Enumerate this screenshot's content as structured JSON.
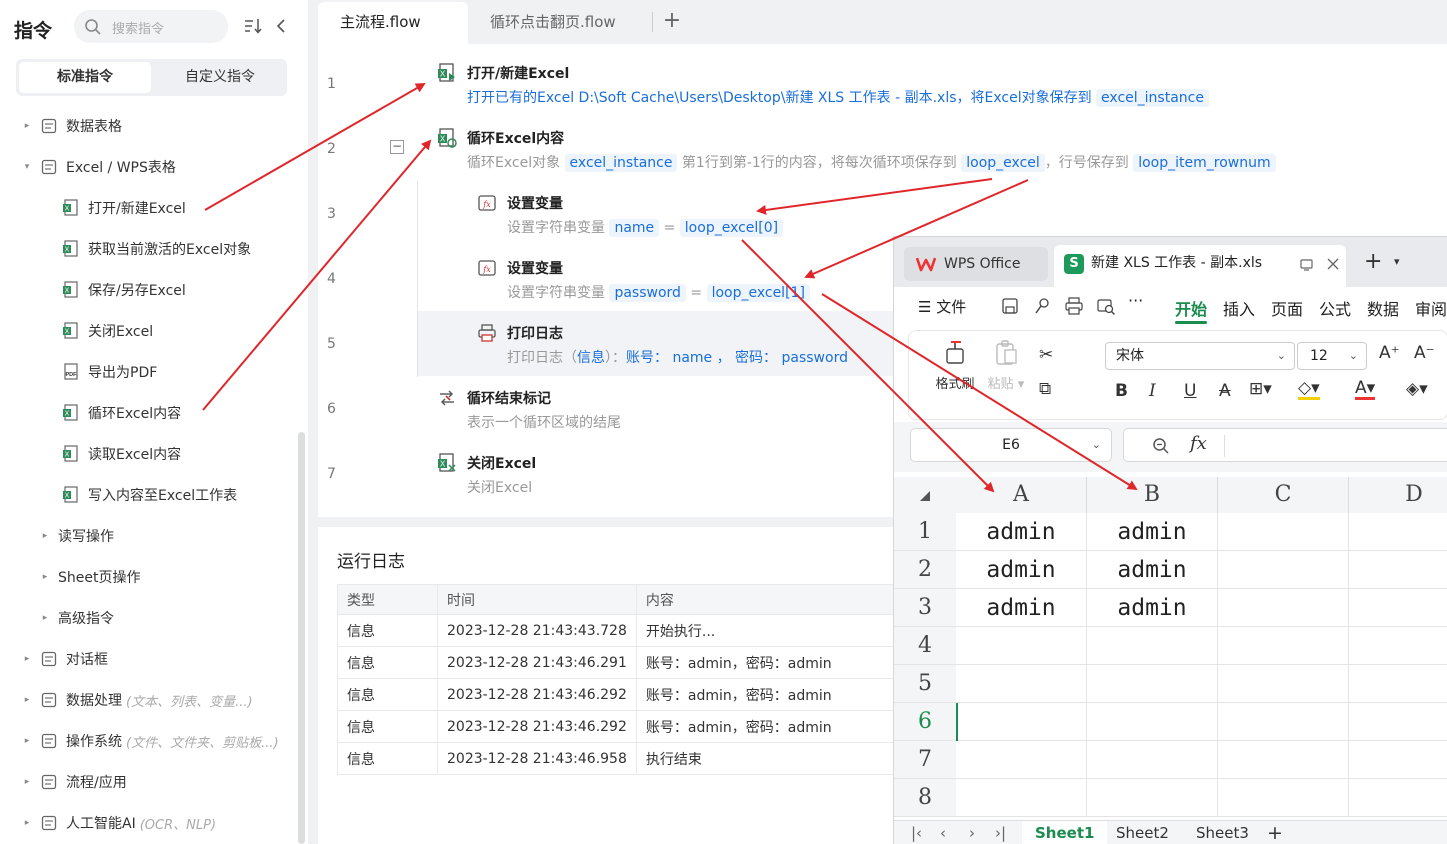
{
  "sidebar": {
    "title": "指令",
    "search_placeholder": "搜索指令",
    "tabs": [
      "标准指令",
      "自定义指令"
    ],
    "tree": [
      {
        "label": "数据表格",
        "level": 0,
        "arrow": "▸",
        "icon": "table-icon"
      },
      {
        "label": "Excel / WPS表格",
        "level": 0,
        "arrow": "▾",
        "icon": "excel-group-icon"
      },
      {
        "label": "打开/新建Excel",
        "level": 2,
        "arrow": "",
        "icon": "excel-open-icon"
      },
      {
        "label": "获取当前激活的Excel对象",
        "level": 2,
        "arrow": "",
        "icon": "excel-active-icon"
      },
      {
        "label": "保存/另存Excel",
        "level": 2,
        "arrow": "",
        "icon": "excel-save-icon"
      },
      {
        "label": "关闭Excel",
        "level": 2,
        "arrow": "",
        "icon": "excel-close-icon"
      },
      {
        "label": "导出为PDF",
        "level": 2,
        "arrow": "",
        "icon": "pdf-icon"
      },
      {
        "label": "循环Excel内容",
        "level": 2,
        "arrow": "",
        "icon": "excel-loop-icon"
      },
      {
        "label": "读取Excel内容",
        "level": 2,
        "arrow": "",
        "icon": "excel-read-icon"
      },
      {
        "label": "写入内容至Excel工作表",
        "level": 2,
        "arrow": "",
        "icon": "excel-write-icon"
      },
      {
        "label": "读写操作",
        "level": 1,
        "arrow": "▸",
        "icon": ""
      },
      {
        "label": "Sheet页操作",
        "level": 1,
        "arrow": "▸",
        "icon": ""
      },
      {
        "label": "高级指令",
        "level": 1,
        "arrow": "▸",
        "icon": ""
      },
      {
        "label": "对话框",
        "level": 0,
        "arrow": "▸",
        "icon": "dialog-icon"
      },
      {
        "label": "数据处理",
        "level": 0,
        "arrow": "▸",
        "icon": "data-process-icon",
        "hint": "(文本、列表、变量...)"
      },
      {
        "label": "操作系统",
        "level": 0,
        "arrow": "▸",
        "icon": "os-icon",
        "hint": "(文件、文件夹、剪贴板...)"
      },
      {
        "label": "流程/应用",
        "level": 0,
        "arrow": "▸",
        "icon": "flow-app-icon"
      },
      {
        "label": "人工智能AI",
        "level": 0,
        "arrow": "▸",
        "icon": "ai-icon",
        "hint": "(OCR、NLP)"
      }
    ]
  },
  "flow_tabs": [
    "主流程.flow",
    "循环点击翻页.flow"
  ],
  "flow": {
    "line_numbers": [
      "1",
      "2",
      "3",
      "4",
      "5",
      "6",
      "7"
    ],
    "step1": {
      "title": "打开/新建Excel",
      "desc": "打开已有的Excel D:\\Soft Cache\\Users\\Desktop\\新建 XLS 工作表 - 副本.xls，将Excel对象保存到",
      "var": "excel_instance"
    },
    "step2": {
      "title": "循环Excel内容",
      "desc_a": "循环Excel对象",
      "var_a": "excel_instance",
      "desc_b": "第1行到第-1行的内容，将每次循环项保存到",
      "var_b": "loop_excel",
      "desc_c": "，行号保存到",
      "var_c": "loop_item_rownum"
    },
    "step3": {
      "title": "设置变量",
      "desc": "设置字符串变量",
      "var": "name",
      "eq": "=",
      "val": "loop_excel[0]"
    },
    "step4": {
      "title": "设置变量",
      "desc": "设置字符串变量",
      "var": "password",
      "eq": "=",
      "val": "loop_excel[1]"
    },
    "step5": {
      "title": "打印日志",
      "desc_a": "打印日志（",
      "level": "信息",
      "desc_b": "）：",
      "content": "账号：  name ， 密码：  password"
    },
    "step6": {
      "title": "循环结束标记",
      "desc": "表示一个循环区域的结尾"
    },
    "step7": {
      "title": "关闭Excel",
      "desc": "关闭Excel"
    }
  },
  "log": {
    "title": "运行日志",
    "headers": [
      "类型",
      "时间",
      "内容"
    ],
    "rows": [
      [
        "信息",
        "2023-12-28 21:43:43.728",
        "开始执行..."
      ],
      [
        "信息",
        "2023-12-28 21:43:46.291",
        "账号：admin，密码：admin"
      ],
      [
        "信息",
        "2023-12-28 21:43:46.292",
        "账号：admin，密码：admin"
      ],
      [
        "信息",
        "2023-12-28 21:43:46.292",
        "账号：admin，密码：admin"
      ],
      [
        "信息",
        "2023-12-28 21:43:46.958",
        "执行结束"
      ]
    ]
  },
  "wps": {
    "home_tab": "WPS Office",
    "doc_tab": "新建 XLS 工作表 - 副本.xls",
    "doc_logo": "S",
    "menu": {
      "file": "文件",
      "items": [
        "开始",
        "插入",
        "页面",
        "公式",
        "数据",
        "审阅"
      ]
    },
    "ribbon": {
      "format_painter": "格式刷",
      "paste": "粘贴",
      "font": "宋体",
      "size": "12"
    },
    "name_box": "E6",
    "fx": "fx",
    "columns": [
      "A",
      "B",
      "C",
      "D"
    ],
    "rows": [
      "1",
      "2",
      "3",
      "4",
      "5",
      "6",
      "7",
      "8"
    ],
    "cells": [
      [
        "admin",
        "admin"
      ],
      [
        "admin",
        "admin"
      ],
      [
        "admin",
        "admin"
      ]
    ],
    "sheets": [
      "Sheet1",
      "Sheet2",
      "Sheet3"
    ],
    "accent": "#1a8c4e"
  },
  "annotation_color": "#e0262a"
}
